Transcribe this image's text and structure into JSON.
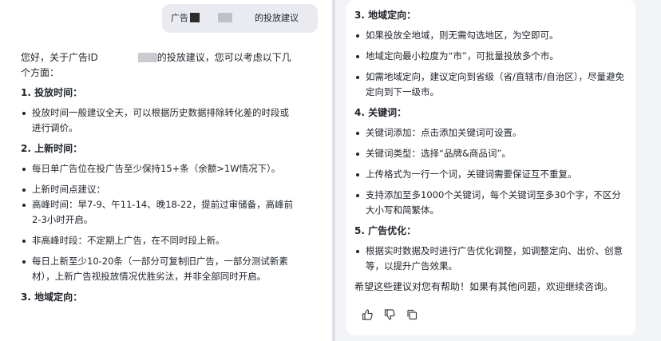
{
  "user_message": {
    "prefix": "广告",
    "suffix": "的投放建议"
  },
  "left": {
    "intro_a": "您好，关于广告ID",
    "intro_b": "的投放建议，您可以考虑以下几个方面：",
    "s1_title": "1. 投放时间：",
    "s1_items": [
      "投放时间一般建议全天，可以根据历史数据排除转化差的时段或进行调价。"
    ],
    "s2_title": "2. 上新时间：",
    "s2_items": [
      "每日单广告位在投广告至少保持15+条（余额>1W情况下）。",
      "上新时间点建议：",
      "高峰时间：早7-9、午11-14、晚18-22，提前过审储备，高峰前2-3小时开启。",
      "非高峰时段：不定期上广告，在不同时段上新。",
      "每日上新至少10-20条（一部分可复制旧广告，一部分测试新素材），上新广告视投放情况优胜劣汰，并非全部同时开启。"
    ],
    "s3_title": "3. 地域定向："
  },
  "right": {
    "s3_title": "3. 地域定向：",
    "s3_items": [
      "如果投放全地域，则无需勾选地区，为空即可。",
      "地域定向最小粒度为“市”，可批量投放多个市。",
      "如需地域定向，建议定向到省级（省/直辖市/自治区），尽量避免定向到下一级市。"
    ],
    "s4_title": "4. 关键词：",
    "s4_items": [
      "关键词添加：点击添加关键词可设置。",
      "关键词类型：选择“品牌&商品词”。",
      "上传格式为一行一个词，关键词需要保证互不重复。",
      "支持添加至多1000个关键词，每个关键词至多30个字，不区分大小写和简繁体。"
    ],
    "s5_title": "5. 广告优化：",
    "s5_items": [
      "根据实时数据及时进行广告优化调整，如调整定向、出价、创意等，以提升广告效果。"
    ],
    "closing": "希望这些建议对您有帮助！如果有其他问题，欢迎继续咨询。"
  },
  "icons": {
    "like": "thumbs-up-icon",
    "dislike": "thumbs-down-icon",
    "copy": "copy-icon"
  }
}
